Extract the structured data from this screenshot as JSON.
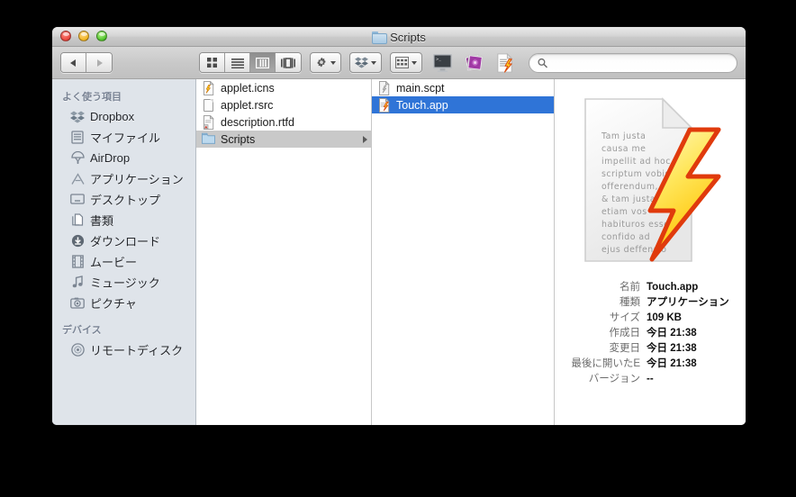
{
  "window": {
    "title": "Scripts",
    "title_icon": "folder-icon",
    "traffic_lights": [
      {
        "name": "close-button",
        "color": "#e8453c"
      },
      {
        "name": "minimize-button",
        "color": "#f0b420"
      },
      {
        "name": "zoom-button",
        "color": "#4fc22a"
      }
    ]
  },
  "toolbar": {
    "back_label": "back-arrow-icon",
    "forward_label": "forward-arrow-icon",
    "view_modes": [
      {
        "name": "icon-view",
        "active": false
      },
      {
        "name": "list-view",
        "active": false
      },
      {
        "name": "column-view",
        "active": true
      },
      {
        "name": "coverflow-view",
        "active": false
      }
    ],
    "action_menu": "gear-icon",
    "dropbox_menu": "dropbox-icon",
    "arrange_menu": "arrange-icon",
    "terminal_button": "terminal-icon",
    "photos_button": "photos-app-icon",
    "applescript_button": "applescript-document-icon",
    "search": {
      "placeholder": "",
      "value": "",
      "icon": "search-icon"
    }
  },
  "sidebar": {
    "sections": [
      {
        "header": "よく使う項目",
        "items": [
          {
            "label": "Dropbox",
            "icon": "dropbox-icon"
          },
          {
            "label": "マイファイル",
            "icon": "my-files-icon"
          },
          {
            "label": "AirDrop",
            "icon": "airdrop-icon"
          },
          {
            "label": "アプリケーション",
            "icon": "applications-icon"
          },
          {
            "label": "デスクトップ",
            "icon": "desktop-icon"
          },
          {
            "label": "書類",
            "icon": "documents-icon"
          },
          {
            "label": "ダウンロード",
            "icon": "downloads-icon"
          },
          {
            "label": "ムービー",
            "icon": "movies-icon"
          },
          {
            "label": "ミュージック",
            "icon": "music-icon"
          },
          {
            "label": "ピクチャ",
            "icon": "pictures-icon"
          }
        ]
      },
      {
        "header": "デバイス",
        "items": [
          {
            "label": "リモートディスク",
            "icon": "remote-disk-icon"
          }
        ]
      }
    ]
  },
  "columns": [
    {
      "name": "column-one",
      "rows": [
        {
          "label": "applet.icns",
          "icon": "icns-file-icon",
          "selected": false,
          "has_chevron": false
        },
        {
          "label": "applet.rsrc",
          "icon": "generic-file-icon",
          "selected": false,
          "has_chevron": false
        },
        {
          "label": "description.rtfd",
          "icon": "rtfd-file-icon",
          "selected": false,
          "has_chevron": false
        },
        {
          "label": "Scripts",
          "icon": "folder-icon",
          "selected": "gray",
          "has_chevron": true
        }
      ]
    },
    {
      "name": "column-two",
      "rows": [
        {
          "label": "main.scpt",
          "icon": "script-file-icon",
          "selected": false,
          "has_chevron": false
        },
        {
          "label": "Touch.app",
          "icon": "applescript-app-icon",
          "selected": "blue",
          "has_chevron": false
        }
      ]
    }
  ],
  "preview": {
    "icon_name": "applescript-applet-icon",
    "icon_body_text": "Tam justa causa me impellit ad hoc scriptum vobis offerendum, & tam justam etiam vos habituros esse confido ad ejus deffensio",
    "metadata": [
      {
        "label": "名前",
        "value": "Touch.app"
      },
      {
        "label": "種類",
        "value": "アプリケーション"
      },
      {
        "label": "サイズ",
        "value": "109 KB"
      },
      {
        "label": "作成日",
        "value": "今日 21:38"
      },
      {
        "label": "変更日",
        "value": "今日 21:38"
      },
      {
        "label": "最後に開いたE",
        "value": "今日 21:38"
      },
      {
        "label": "バージョン",
        "value": "--"
      }
    ]
  },
  "colors": {
    "selection_blue": "#2f74d7",
    "selection_gray": "#c9c9c9",
    "sidebar_bg": "#dfe4ea",
    "desktop_bg": "#000000"
  }
}
